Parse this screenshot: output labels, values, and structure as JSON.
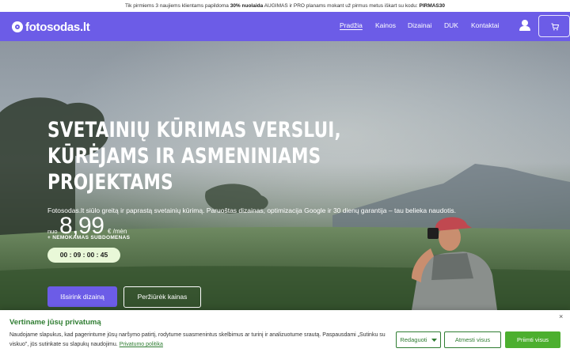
{
  "promo": {
    "part1": "Tik pirmiems 3 naujiems klientams papildoma ",
    "discount": "30% nuolaida",
    "part2": " AUGIMAS ir PRO planams mokant už pirmus metus iškart su kodu: ",
    "code": "PIRMAS30"
  },
  "header": {
    "logo_text": "fotosodas.lt",
    "nav": [
      "Pradžia",
      "Kainos",
      "Dizainai",
      "DUK",
      "Kontaktai"
    ],
    "active_nav": "Pradžia"
  },
  "hero": {
    "title_lines": [
      "SVETAINIŲ KŪRIMAS VERSLUI,",
      "KŪRĖJAMS IR ASMENINIAMS",
      "PROJEKTAMS"
    ],
    "description": "Fotosodas.lt siūlo greitą ir paprastą svetainių kūrimą. Paruoštas dizainas, optimizacija Google ir 30 dienų garantija – tau belieka naudotis.",
    "price_prefix": "nuo",
    "price": "8,99",
    "price_suffix": "€ /mėn",
    "bonus": "+ NEMOKAMAS SUBDOMENAS",
    "timer": "00 : 09 : 00 : 45",
    "primary_button": "Išsirink dizainą",
    "secondary_button": "Peržiūrėk kainas"
  },
  "cookie": {
    "title": "Vertiname jūsų privatumą",
    "text": "Naudojame slapukus, kad pagerintume jūsų naršymo patirtį, rodytume suasmenintus skelbimus ar turinį ir analizuotume srautą. Paspausdami „Sutinku su viskuo\", jūs sutinkate su slapukų naudojimu.",
    "link": "Privatumo politika",
    "edit_button": "Redaguoti",
    "reject_button": "Atmesti visus",
    "accept_button": "Priimti visus",
    "close": "×"
  },
  "colors": {
    "brand": "#6c5ce7",
    "cookie_accent": "#2f7d32",
    "accept_green": "#4caf2f",
    "timer_bg": "#e9f8d8"
  },
  "icons": {
    "logo": "logo-circle-icon",
    "user": "user-icon",
    "cart": "cart-icon",
    "close": "close-icon",
    "dropdown": "chevron-down-icon"
  }
}
